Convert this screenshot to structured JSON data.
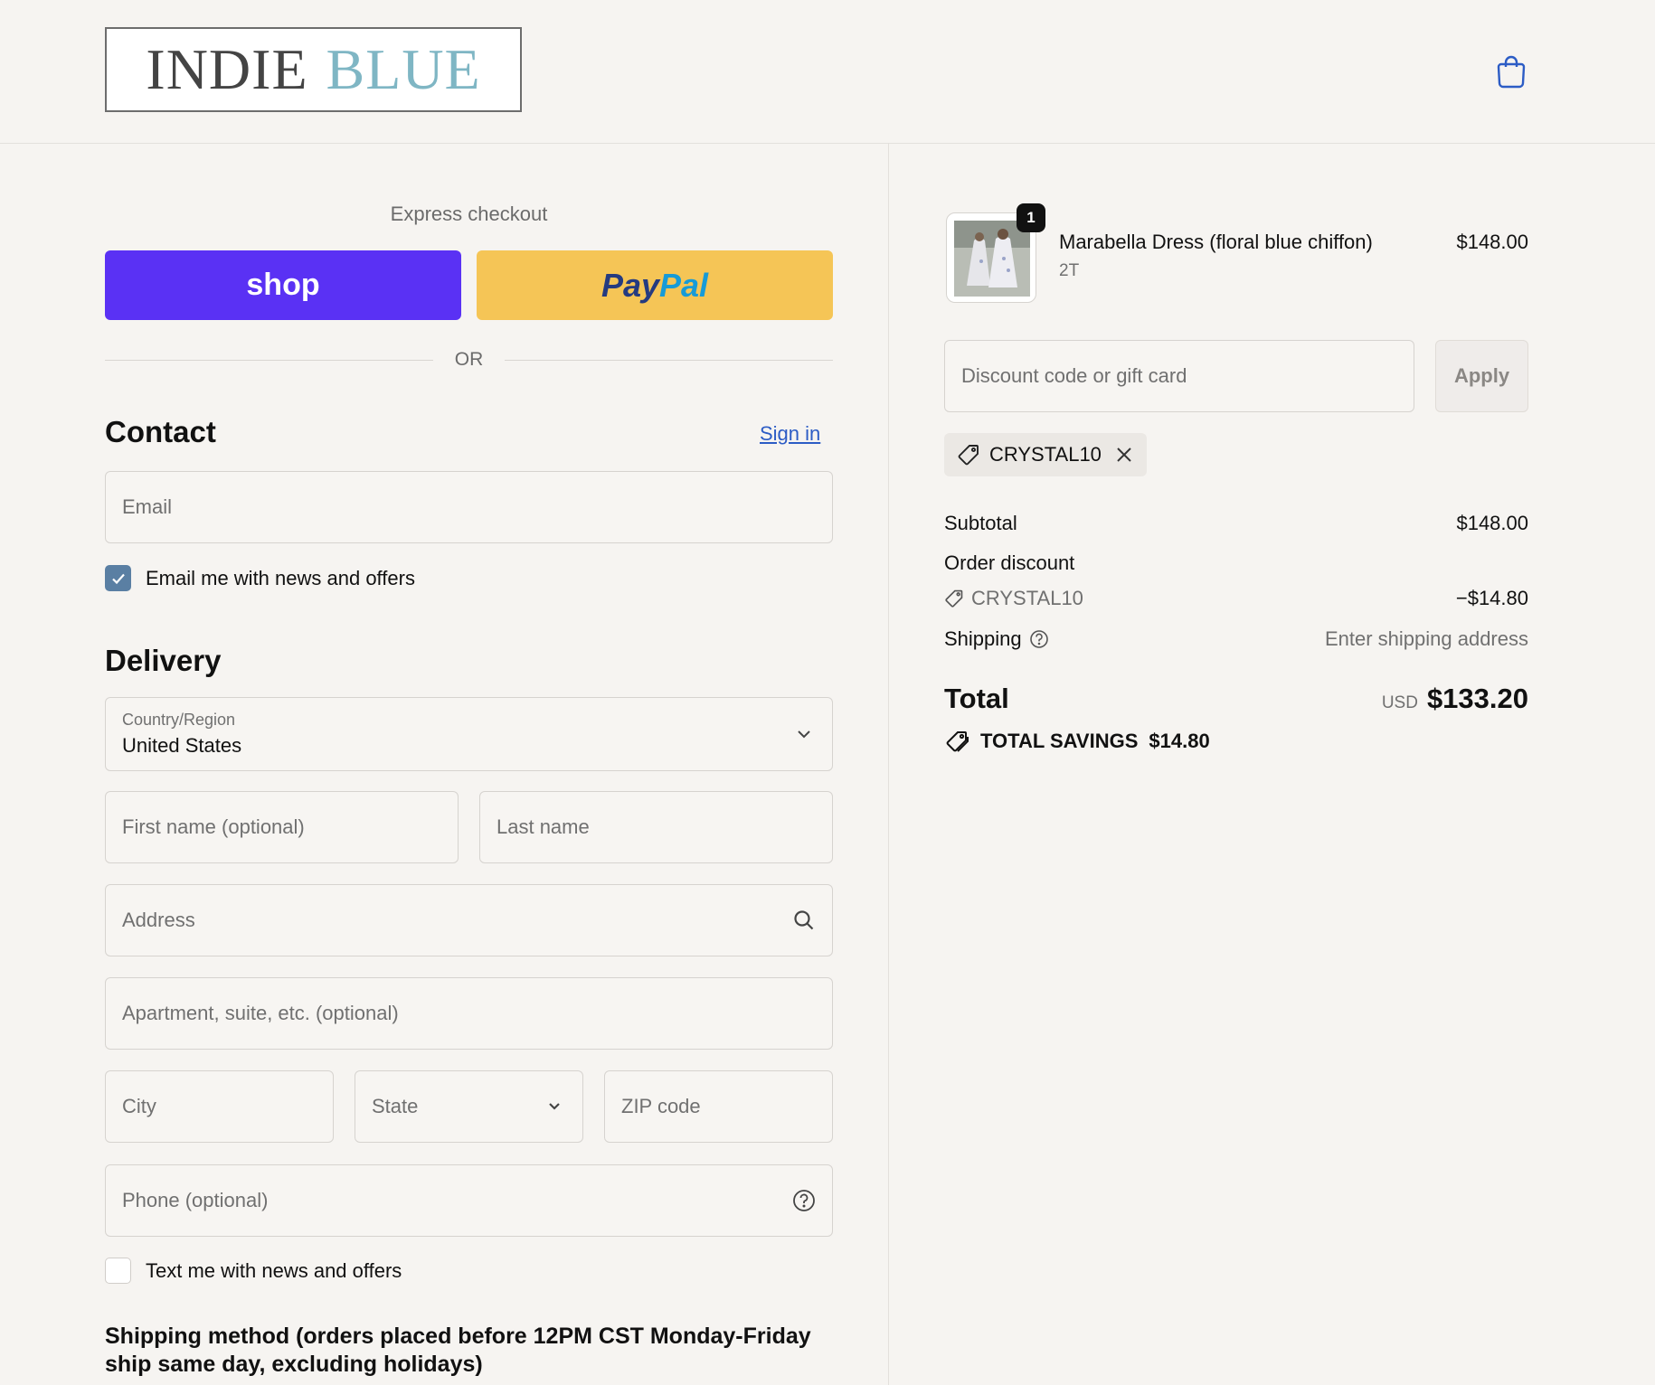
{
  "header": {
    "logo_word1": "INDIE",
    "logo_word2": "BLUE",
    "cart_icon": "shopping-bag-icon"
  },
  "express": {
    "title": "Express checkout",
    "shop_label": "shop",
    "paypal_pay": "Pay",
    "paypal_pal": "Pal",
    "or_label": "OR"
  },
  "contact": {
    "title": "Contact",
    "sign_in": "Sign in",
    "email_placeholder": "Email",
    "newsletter_label": "Email me with news and offers",
    "newsletter_checked": true
  },
  "delivery": {
    "title": "Delivery",
    "country_label": "Country/Region",
    "country_value": "United States",
    "first_name_placeholder": "First name (optional)",
    "last_name_placeholder": "Last name",
    "address_placeholder": "Address",
    "apartment_placeholder": "Apartment, suite, etc. (optional)",
    "city_placeholder": "City",
    "state_placeholder": "State",
    "zip_placeholder": "ZIP code",
    "phone_placeholder": "Phone (optional)",
    "sms_label": "Text me with news and offers",
    "sms_checked": false
  },
  "shipping_method": {
    "title": "Shipping method (orders placed before 12PM CST Monday-Friday ship same day, excluding holidays)"
  },
  "summary": {
    "item": {
      "quantity": "1",
      "name": "Marabella Dress (floral blue chiffon)",
      "variant": "2T",
      "price": "$148.00"
    },
    "discount_placeholder": "Discount code or gift card",
    "apply_label": "Apply",
    "applied_code": "CRYSTAL10",
    "subtotal_label": "Subtotal",
    "subtotal_value": "$148.00",
    "order_discount_label": "Order discount",
    "discount_code": "CRYSTAL10",
    "discount_value": "−$14.80",
    "shipping_label": "Shipping",
    "shipping_value": "Enter shipping address",
    "total_label": "Total",
    "total_currency": "USD",
    "total_value": "$133.20",
    "savings_label": "TOTAL SAVINGS",
    "savings_value": "$14.80"
  },
  "colors": {
    "background": "#f6f4f1",
    "shop_purple": "#5a31f4",
    "paypal_yellow": "#f5c556",
    "link_blue": "#2c5cc5",
    "checkbox_blue": "#5a7fa3"
  }
}
